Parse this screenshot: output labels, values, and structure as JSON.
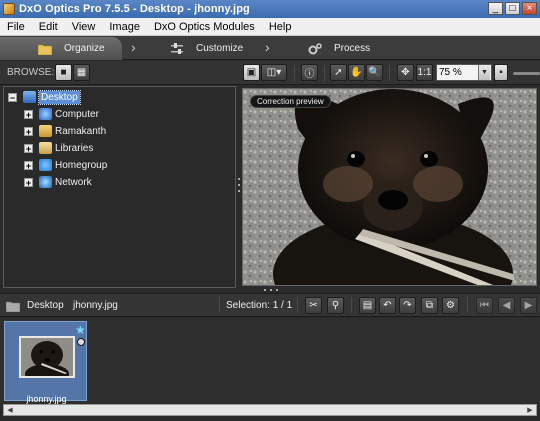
{
  "window": {
    "title": "DxO Optics Pro 7.5.5 - Desktop - jhonny.jpg"
  },
  "menu": [
    "File",
    "Edit",
    "View",
    "Image",
    "DxO Optics Modules",
    "Help"
  ],
  "tabs": {
    "organize": "Organize",
    "customize": "Customize",
    "process": "Process"
  },
  "toolbar": {
    "browse_label": "BROWSE:",
    "zoom_value": "75 %",
    "zoom_fit": "1:1"
  },
  "tree": {
    "root": "Desktop",
    "items": [
      "Computer",
      "Ramakanth",
      "Libraries",
      "Homegroup",
      "Network"
    ]
  },
  "preview": {
    "label": "Correction preview"
  },
  "lowerbar": {
    "folder": "Desktop",
    "file": "jhonny.jpg",
    "selection": "Selection: 1 / 1"
  },
  "filmstrip": {
    "thumb_name": "jhonny.jpg"
  }
}
